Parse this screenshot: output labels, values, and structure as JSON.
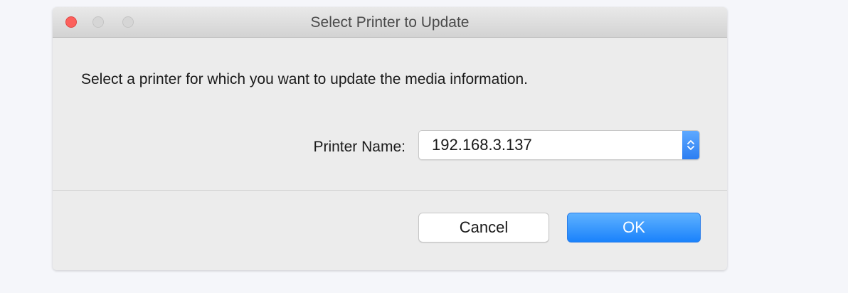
{
  "window": {
    "title": "Select Printer to Update"
  },
  "body": {
    "message": "Select a printer for which you want to update the media information.",
    "printer_label": "Printer Name:",
    "printer_value": "192.168.3.137"
  },
  "buttons": {
    "cancel": "Cancel",
    "ok": "OK"
  },
  "colors": {
    "accent": "#1a82fb",
    "close_button": "#fc605c"
  },
  "icons": {
    "select_arrows": "up-down-chevron-icon"
  }
}
